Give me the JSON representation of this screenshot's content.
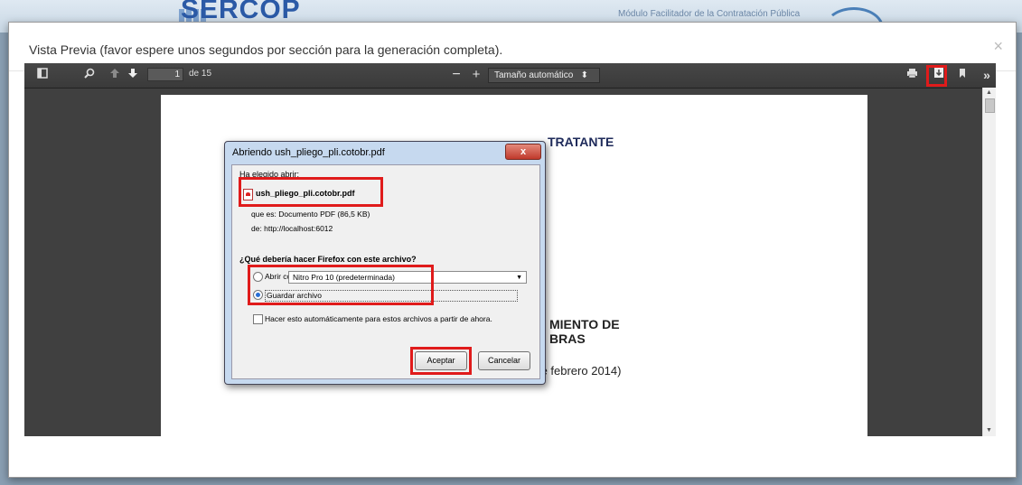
{
  "site": {
    "logo": "SERCOP",
    "module_text": "Módulo Facilitador de la Contratación Pública"
  },
  "modal": {
    "title": "Vista Previa (favor espere unos segundos por sección para la generación completa).",
    "close": "×"
  },
  "viewer": {
    "page_number": "1",
    "page_total": "de 15",
    "zoom_minus": "−",
    "zoom_plus": "+",
    "zoom_value": "Tamaño automático",
    "tools_more": "»"
  },
  "document": {
    "line1": "TRATANTE",
    "line2": "MIENTO DE",
    "line3": "BRAS",
    "version": "Versión SERCOP 1.1 (20 de febrero 2014)"
  },
  "dialog": {
    "title": "Abriendo ush_pliego_pli.cotobr.pdf",
    "close": "x",
    "chosen_label": "Ha elegido abrir:",
    "filename": "ush_pliego_pli.cotobr.pdf",
    "type_line": "que es:  Documento PDF (86,5 KB)",
    "from_line": "de:  http://localhost:6012",
    "question": "¿Qué debería hacer Firefox con este archivo?",
    "open_with_label": "Abrir con",
    "open_with_value": "Nitro Pro 10 (predeterminada)",
    "save_label": "Guardar archivo",
    "auto_label": "Hacer esto automáticamente para estos archivos a partir de ahora.",
    "accept": "Aceptar",
    "cancel": "Cancelar"
  },
  "colors": {
    "highlight": "#e01b1b",
    "logo": "#2b5aa6",
    "viewer_bg": "#404040"
  }
}
